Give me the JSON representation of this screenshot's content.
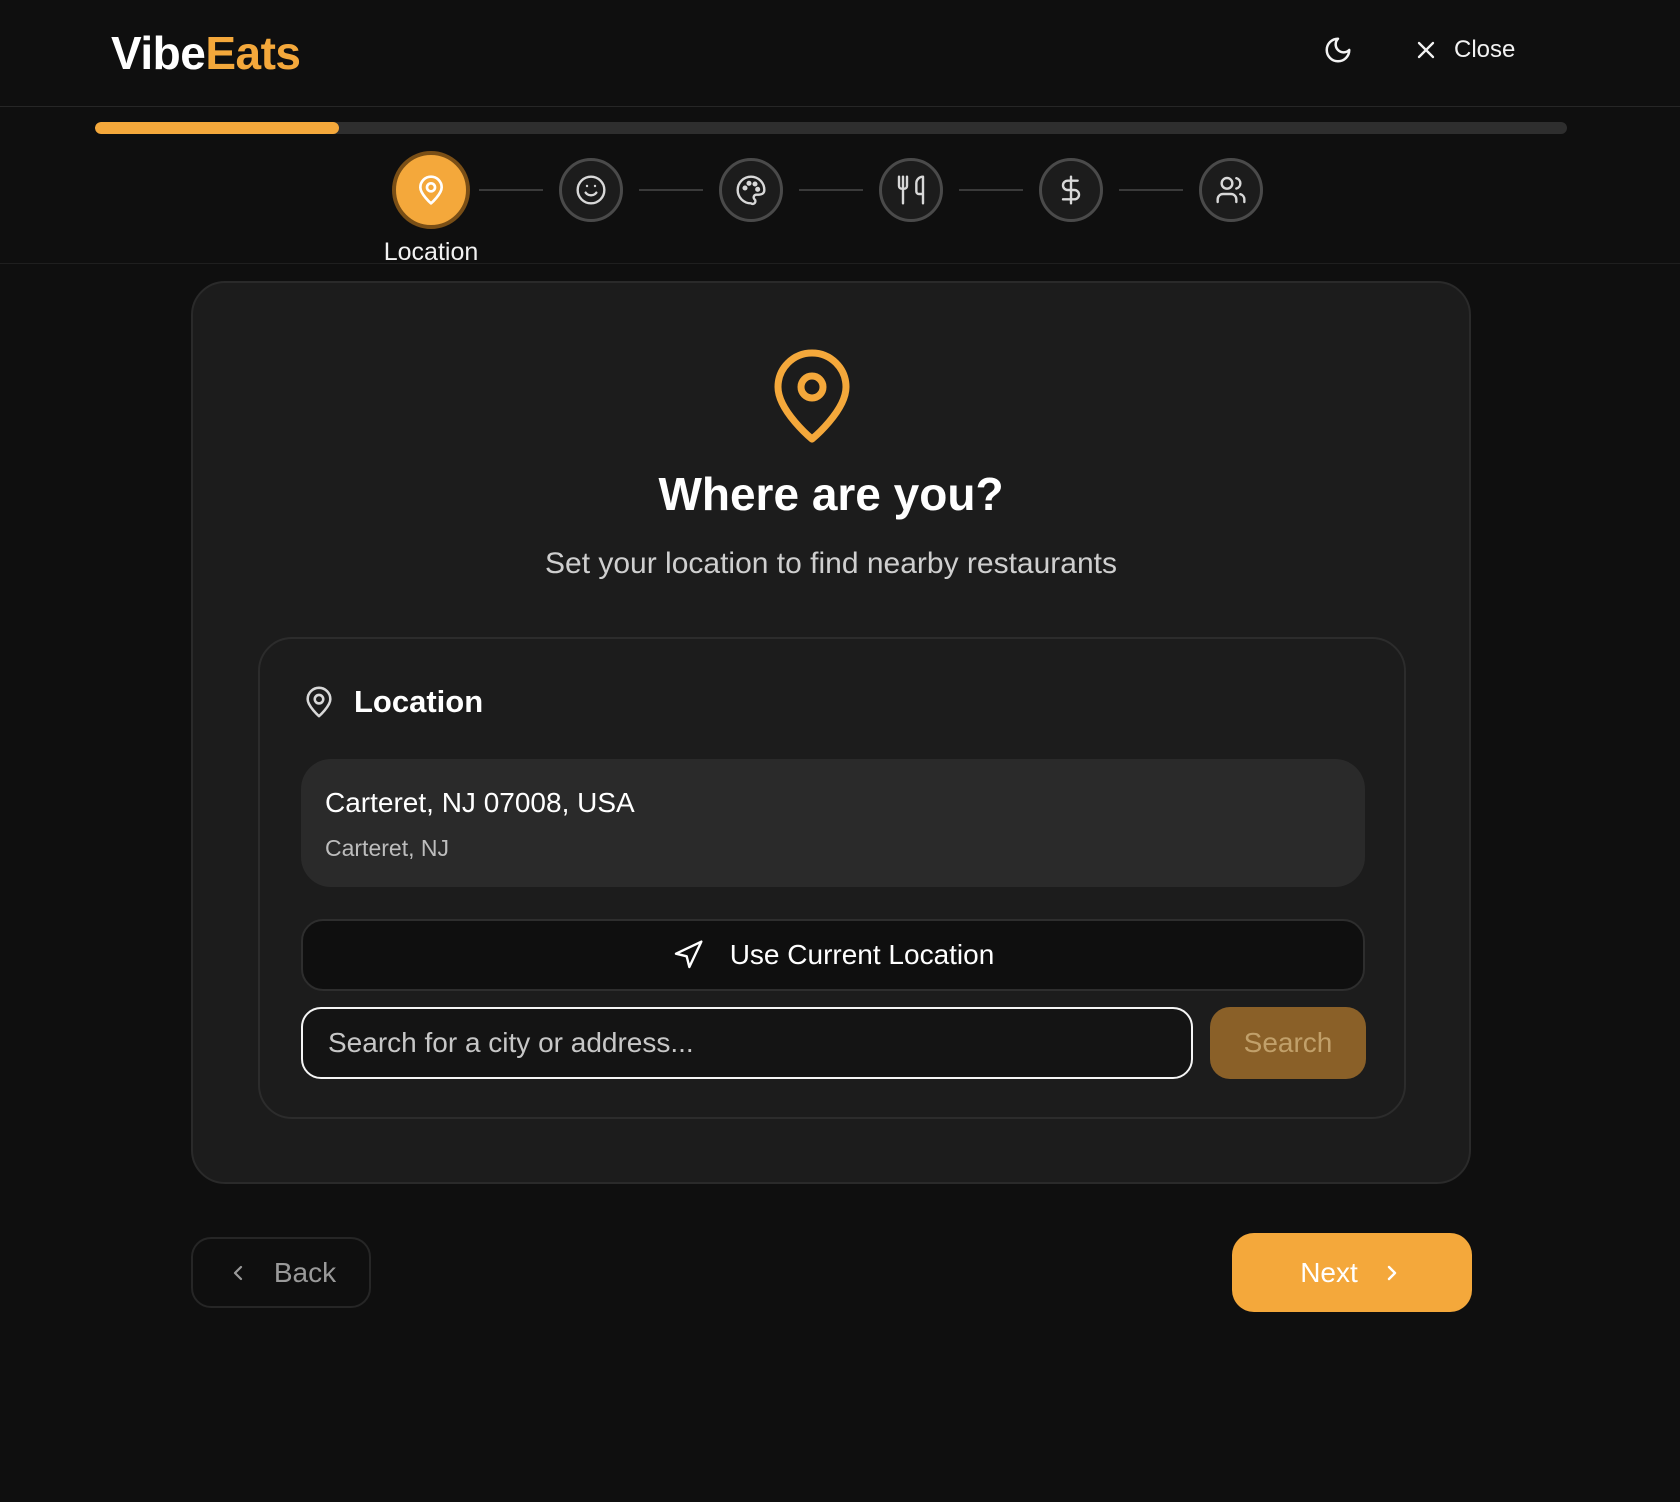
{
  "app": {
    "logo_part1": "Vibe",
    "logo_part2": "Eats",
    "close_label": "Close",
    "accent_color": "#f4a83b"
  },
  "progress": {
    "fraction": 0.166
  },
  "stepper": {
    "steps": [
      {
        "icon": "map-pin-icon",
        "label": "Location",
        "active": true
      },
      {
        "icon": "smile-icon",
        "active": false
      },
      {
        "icon": "palette-icon",
        "active": false
      },
      {
        "icon": "utensils-icon",
        "active": false
      },
      {
        "icon": "dollar-icon",
        "active": false
      },
      {
        "icon": "users-icon",
        "active": false
      }
    ],
    "active_label": "Location"
  },
  "card": {
    "title": "Where are you?",
    "subtitle": "Set your location to find nearby restaurants",
    "section_title": "Location",
    "selected_location": {
      "primary": "Carteret, NJ 07008, USA",
      "secondary": "Carteret, NJ"
    },
    "use_current_label": "Use Current Location",
    "search_placeholder": "Search for a city or address...",
    "search_value": "",
    "search_button": "Search"
  },
  "footer": {
    "back_label": "Back",
    "next_label": "Next"
  }
}
